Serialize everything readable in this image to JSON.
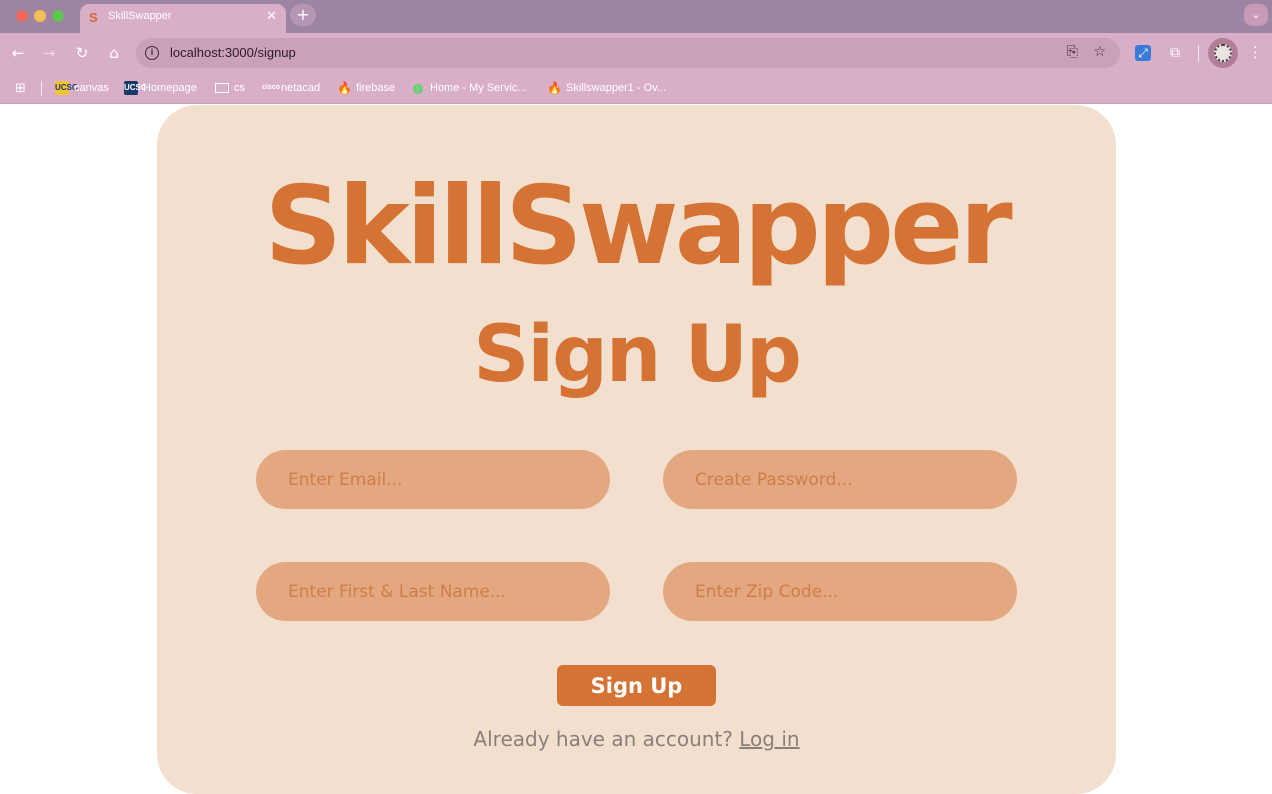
{
  "browser": {
    "tab_title": "SkillSwapper",
    "tab_favicon": "S",
    "url": "localhost:3000/signup",
    "bookmarks": [
      {
        "label": "canvas",
        "icon": "ucsc-icon",
        "icon_text": "UCSC"
      },
      {
        "label": "Homepage",
        "icon": "homepage-icon",
        "icon_text": "UCSC"
      },
      {
        "label": "cs",
        "icon": "folder-icon",
        "icon_text": ""
      },
      {
        "label": "netacad",
        "icon": "cisco-icon",
        "icon_text": "cisco"
      },
      {
        "label": "firebase",
        "icon": "firebase-icon",
        "icon_text": "🔥"
      },
      {
        "label": "Home - My Servic...",
        "icon": "render-icon",
        "icon_text": "◍"
      },
      {
        "label": "Skillswapper1 - Ov...",
        "icon": "firebase-icon",
        "icon_text": "🔥"
      }
    ]
  },
  "page": {
    "logo": "SkillSwapper",
    "heading": "Sign Up",
    "fields": {
      "email_placeholder": "Enter Email...",
      "password_placeholder": "Create Password...",
      "name_placeholder": "Enter First & Last Name...",
      "zip_placeholder": "Enter Zip Code..."
    },
    "submit_label": "Sign Up",
    "login_prompt": "Already have an account?",
    "login_link": "Log in"
  },
  "colors": {
    "accent": "#d57334",
    "card_background": "#f3dfcd",
    "field_background": "#e4a881",
    "browser_chrome": "#d9afc8"
  }
}
